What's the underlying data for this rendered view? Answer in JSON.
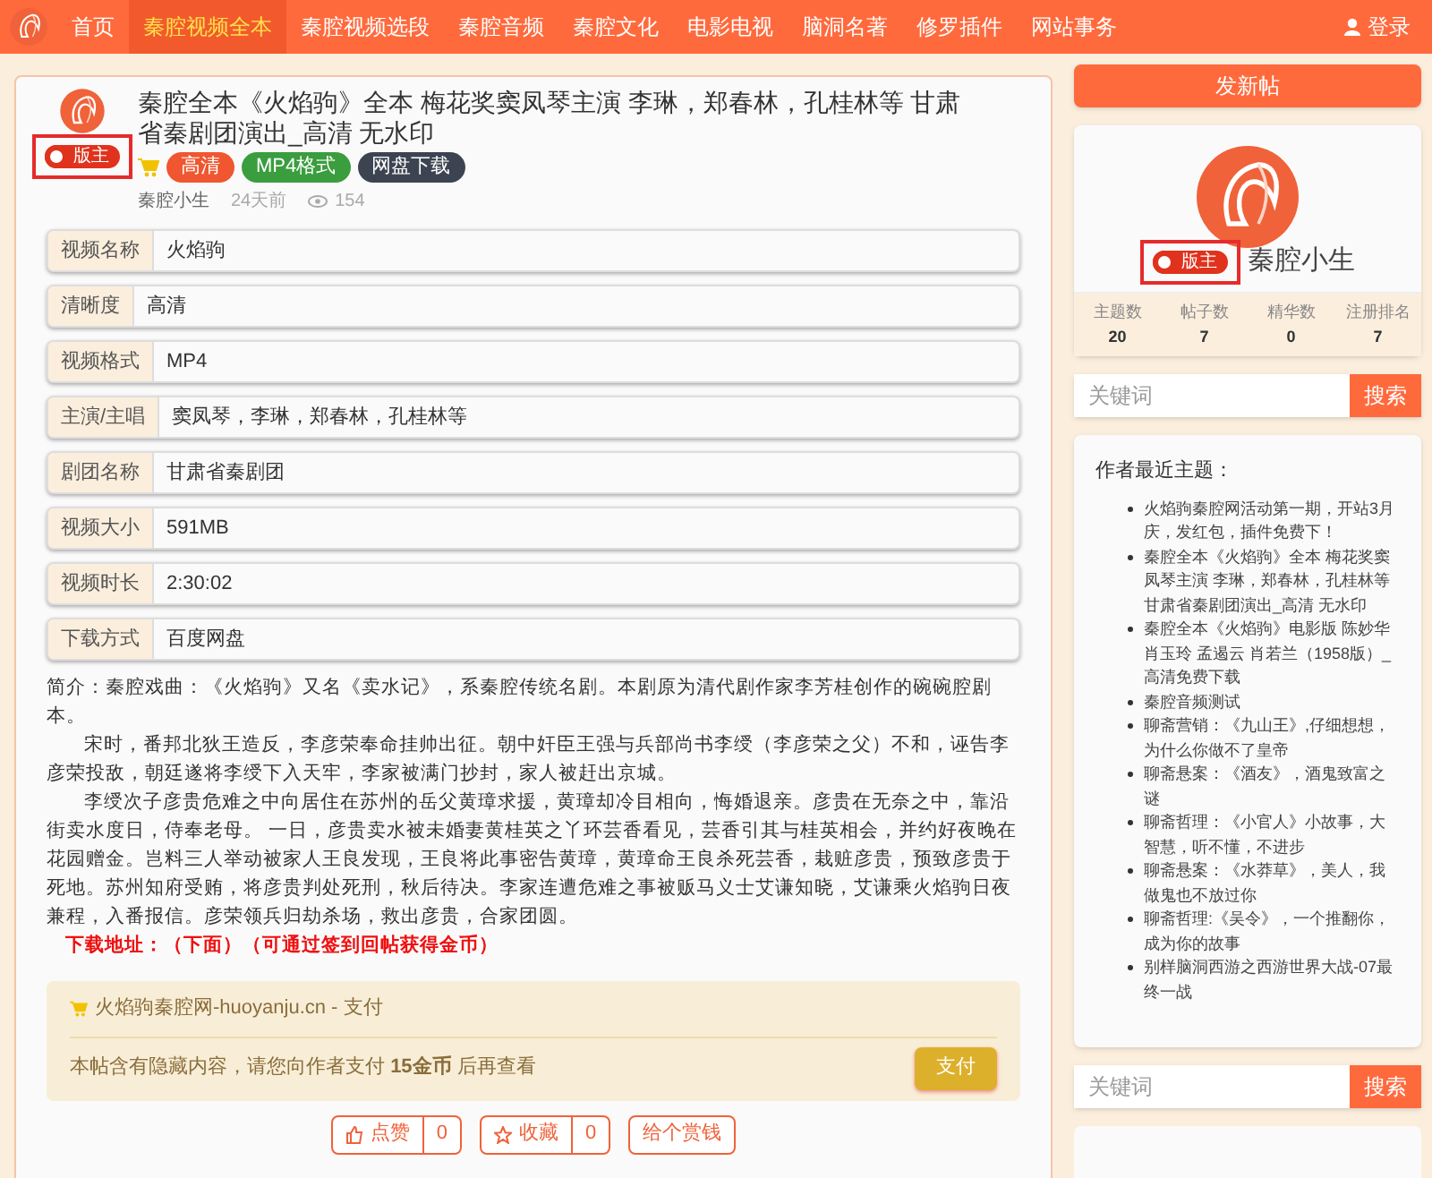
{
  "nav": {
    "items": [
      {
        "label": "首页",
        "selected": false
      },
      {
        "label": "秦腔视频全本",
        "selected": true
      },
      {
        "label": "秦腔视频选段",
        "selected": false
      },
      {
        "label": "秦腔音频",
        "selected": false
      },
      {
        "label": "秦腔文化",
        "selected": false
      },
      {
        "label": "电影电视",
        "selected": false
      },
      {
        "label": "脑洞名著",
        "selected": false
      },
      {
        "label": "修罗插件",
        "selected": false
      },
      {
        "label": "网站事务",
        "selected": false
      }
    ],
    "login": "登录"
  },
  "post": {
    "title": "秦腔全本《火焰驹》全本 梅花奖窦凤琴主演 李琳，郑春林，孔桂林等 甘肃省秦剧团演出_高清 无水印",
    "badge": "版主",
    "tags": [
      {
        "label": "高清",
        "color": "#f0562f"
      },
      {
        "label": "MP4格式",
        "color": "#3a9d3e"
      },
      {
        "label": "网盘下载",
        "color": "#3d4451"
      }
    ],
    "author": "秦腔小生",
    "time": "24天前",
    "views": "154",
    "fields": [
      {
        "label": "视频名称",
        "value": "火焰驹"
      },
      {
        "label": "清晰度",
        "value": "高清"
      },
      {
        "label": "视频格式",
        "value": "MP4"
      },
      {
        "label": "主演/主唱",
        "value": "窦凤琴，李琳，郑春林，孔桂林等"
      },
      {
        "label": "剧团名称",
        "value": "甘肃省秦剧团"
      },
      {
        "label": "视频大小",
        "value": "591MB"
      },
      {
        "label": "视频时长",
        "value": "2:30:02"
      },
      {
        "label": "下载方式",
        "value": "百度网盘"
      }
    ],
    "paragraphs": [
      {
        "kind": "intro",
        "text": "简介：秦腔戏曲：《火焰驹》又名《卖水记》，系秦腔传统名剧。本剧原为清代剧作家李芳桂创作的碗碗腔剧本。"
      },
      {
        "kind": "indent",
        "text": "宋时，番邦北狄王造反，李彦荣奉命挂帅出征。朝中奸臣王强与兵部尚书李绶（李彦荣之父）不和，诬告李彦荣投敌，朝廷遂将李绶下入天牢，李家被满门抄封，家人被赶出京城。"
      },
      {
        "kind": "indent",
        "text": "李绶次子彦贵危难之中向居住在苏州的岳父黄璋求援，黄璋却冷目相向，悔婚退亲。彦贵在无奈之中，靠沿街卖水度日，侍奉老母。 一日，彦贵卖水被未婚妻黄桂英之丫环芸香看见，芸香引其与桂英相会，并约好夜晚在花园赠金。岂料三人举动被家人王良发现，王良将此事密告黄璋，黄璋命王良杀死芸香，栽赃彦贵，预致彦贵于死地。苏州知府受贿，将彦贵判处死刑，秋后待决。李家连遭危难之事被贩马义士艾谦知晓，艾谦乘火焰驹日夜兼程，入番报信。彦荣领兵归劫杀场，救出彦贵，合家团圆。"
      },
      {
        "kind": "download",
        "text": "下载地址：（下面）（可通过签到回帖获得金币）"
      }
    ],
    "pay": {
      "title": "火焰驹秦腔网-huoyanju.cn - 支付",
      "notice": "本帖含有隐藏内容，请您向作者支付 **15金币** 后再查看",
      "button": "支付"
    },
    "actions": [
      {
        "kind": "like",
        "label": "点赞",
        "count": "0"
      },
      {
        "kind": "favorite",
        "label": "收藏",
        "count": "0"
      },
      {
        "kind": "tip",
        "label": "给个赏钱"
      }
    ]
  },
  "sidebar": {
    "new_post": "发新帖",
    "profile": {
      "badge": "版主",
      "name": "秦腔小生",
      "stats": [
        {
          "label": "主题数",
          "value": "20"
        },
        {
          "label": "帖子数",
          "value": "7"
        },
        {
          "label": "精华数",
          "value": "0"
        },
        {
          "label": "注册排名",
          "value": "7"
        }
      ]
    },
    "search": {
      "placeholder": "关键词",
      "button": "搜索"
    },
    "recent": {
      "title": "作者最近主题：",
      "items": [
        "火焰驹秦腔网活动第一期，开站3月庆，发红包，插件免费下！",
        "秦腔全本《火焰驹》全本 梅花奖窦凤琴主演 李琳，郑春林，孔桂林等甘肃省秦剧团演出_高清 无水印",
        "秦腔全本《火焰驹》电影版 陈妙华肖玉玲 孟遏云 肖若兰（1958版）_高清免费下载",
        "秦腔音频测试",
        "聊斋营销：《九山王》,仔细想想，为什么你做不了皇帝",
        "聊斋悬案：《酒友》，酒鬼致富之谜",
        "聊斋哲理：《小官人》小故事，大智慧，听不懂，不进步",
        "聊斋悬案：《水莽草》，美人，我做鬼也不放过你",
        "聊斋哲理:《吴令》，一个推翻你，成为你的故事",
        "别样脑洞西游之西游世界大战-07最终一战"
      ]
    },
    "search2": {
      "placeholder": "关键词",
      "button": "搜索"
    }
  }
}
